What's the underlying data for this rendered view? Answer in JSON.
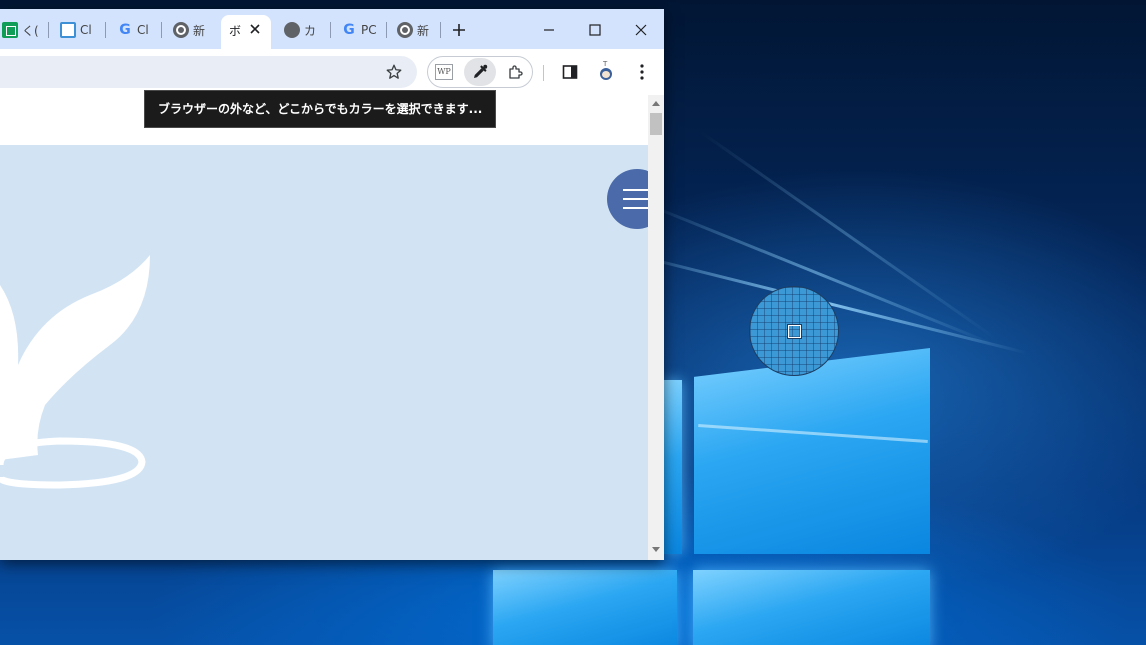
{
  "tabs": [
    {
      "text": "く(",
      "icon": "sheets-icon"
    },
    {
      "text": "Cl",
      "icon": "docs-icon"
    },
    {
      "text": "Cl",
      "icon": "google-icon"
    },
    {
      "text": "新",
      "icon": "chrome-icon"
    },
    {
      "text": "ボ",
      "icon": "none",
      "active": true
    },
    {
      "text": "カ",
      "icon": "globe-icon"
    },
    {
      "text": "PC",
      "icon": "google-icon"
    },
    {
      "text": "新",
      "icon": "chrome-icon"
    }
  ],
  "toolbar": {
    "extension_wp": "WP",
    "avatar_hint": "T"
  },
  "tooltip": {
    "text": "ブラウザーの外など、どこからでもカラーを選択できます..."
  },
  "colors": {
    "tabstrip": "#d3e3fd",
    "content_bg": "#d2e4f4",
    "menu_button": "#4a6aaa",
    "loupe_fill": "#3c99d6"
  }
}
